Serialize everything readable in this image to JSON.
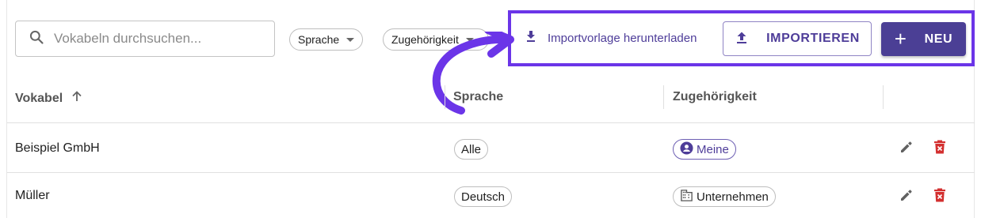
{
  "search": {
    "placeholder": "Vokabeln durchsuchen...",
    "value": ""
  },
  "filters": [
    {
      "label": "Sprache"
    },
    {
      "label": "Zugehörigkeit"
    }
  ],
  "actions": {
    "download_template_label": "Importvorlage herunterladen",
    "import_label": "IMPORTIEREN",
    "new_label": "NEU"
  },
  "table": {
    "columns": [
      {
        "label": "Vokabel",
        "sort": "ascending"
      },
      {
        "label": "Sprache"
      },
      {
        "label": "Zugehörigkeit"
      }
    ],
    "rows": [
      {
        "vokabel": "Beispiel GmbH",
        "sprache": "Alle",
        "zugehoerigkeit": "Meine",
        "zugehoerigkeit_icon": "person-icon"
      },
      {
        "vokabel": "Müller",
        "sprache": "Deutsch",
        "zugehoerigkeit": "Unternehmen",
        "zugehoerigkeit_icon": "building-icon"
      }
    ]
  },
  "colors": {
    "primary": "#4b3f95",
    "highlight": "#6b35e8",
    "delete": "#d32f2f"
  }
}
